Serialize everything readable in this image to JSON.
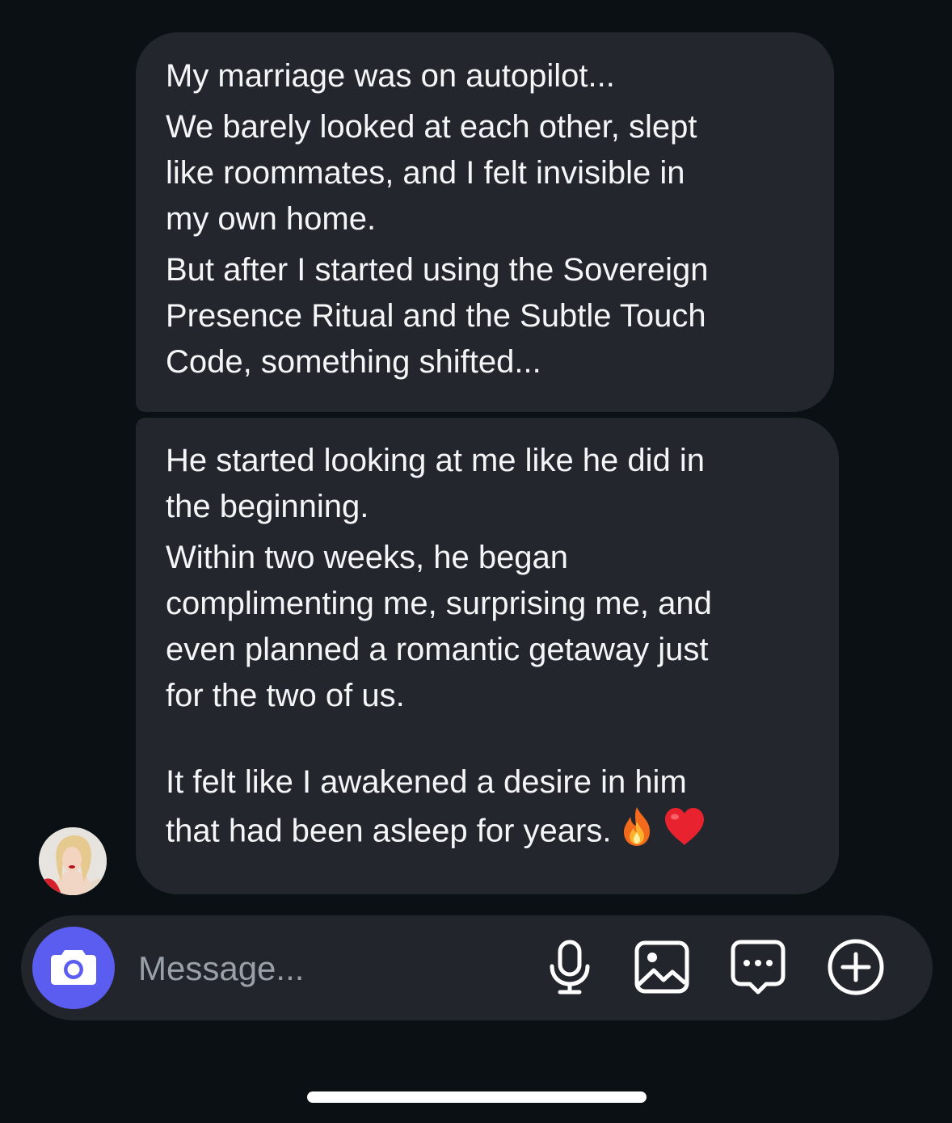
{
  "messages": [
    {
      "paragraphs": [
        "My marriage was on autopilot...",
        "We barely looked at each other, slept\nlike roommates, and I felt invisible in\nmy own home.",
        "But after I started using the Sovereign\nPresence Ritual and the Subtle Touch\nCode, something shifted..."
      ]
    },
    {
      "paragraphs": [
        "He started looking at me like he did in\nthe beginning.",
        "Within two weeks, he began\ncomplimenting me, surprising me, and\neven planned a romantic getaway just\nfor the two of us."
      ],
      "final_text": "It felt like I awakened a desire in him\nthat had been asleep for years.",
      "emojis": [
        "fire-icon",
        "heart-icon"
      ]
    }
  ],
  "composer": {
    "placeholder": "Message...",
    "accent_color": "#5b5cf0",
    "tools": [
      "microphone-icon",
      "image-icon",
      "sticker-chat-icon",
      "plus-circle-icon"
    ]
  }
}
